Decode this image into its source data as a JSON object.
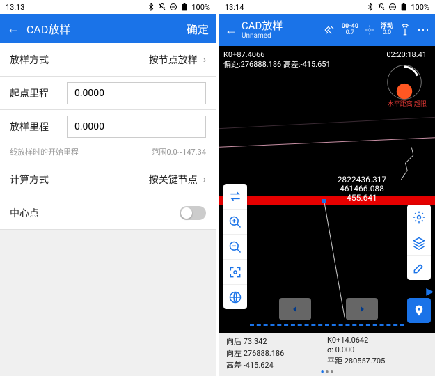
{
  "left": {
    "status": {
      "time": "13:13",
      "battery": "100%"
    },
    "title": "CAD放样",
    "confirm": "确定",
    "rows": {
      "mode_label": "放样方式",
      "mode_value": "按节点放样",
      "start_label": "起点里程",
      "start_value": "0.0000",
      "dist_label": "放样里程",
      "dist_value": "0.0000",
      "hint_left": "线放样时的开始里程",
      "hint_right": "范围0.0~147.34",
      "calc_label": "计算方式",
      "calc_value": "按关键节点",
      "center_label": "中心点"
    }
  },
  "right": {
    "status": {
      "time": "13:14",
      "battery": "100%"
    },
    "title": "CAD放样",
    "subtitle": "Unnamed",
    "ind1_top": "00-40",
    "ind1_bot": "0.7",
    "ind2_top": "浮动",
    "ind2_bot": "0.0",
    "info_top_left_l1": "K0+87.4066",
    "info_top_left_l2": "偏距:276888.186 高差:-415.651",
    "info_top_right": "02:20:18.41",
    "red_hint": "水平距离 超限",
    "coord1": "2822436.317",
    "coord2": "461466.088",
    "coord3": "455.641",
    "bottom": {
      "c1l1": "向后 73.342",
      "c1l2": "向左 276888.186",
      "c1l3": "高差 -415.624",
      "c2l1": "K0+14.0642",
      "c2l2": "σ:   0.000",
      "c2l3": "平距 280557.705"
    }
  }
}
